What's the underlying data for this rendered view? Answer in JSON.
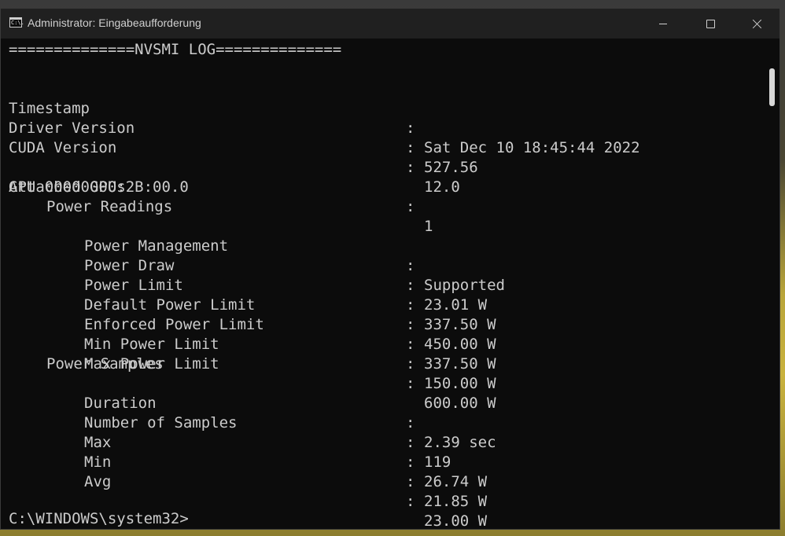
{
  "window": {
    "title": "Administrator: Eingabeaufforderung",
    "icon": "cmd-icon",
    "icon_text": "C:\\."
  },
  "console": {
    "header": "==============NVSMI LOG==============",
    "top_fields": [
      {
        "key": "Timestamp",
        "sep": ":",
        "value": "Sat Dec 10 18:45:44 2022"
      },
      {
        "key": "Driver Version",
        "sep": ":",
        "value": "527.56"
      },
      {
        "key": "CUDA Version",
        "sep": ":",
        "value": "12.0"
      }
    ],
    "attached": {
      "key": "Attached GPUs",
      "sep": ":",
      "value": "1"
    },
    "gpu_id": "GPU 00000000:2B:00.0",
    "power_readings_label": "Power Readings",
    "power_readings": [
      {
        "key": "Power Management",
        "sep": ":",
        "value": "Supported"
      },
      {
        "key": "Power Draw",
        "sep": ":",
        "value": "23.01 W"
      },
      {
        "key": "Power Limit",
        "sep": ":",
        "value": "337.50 W"
      },
      {
        "key": "Default Power Limit",
        "sep": ":",
        "value": "450.00 W"
      },
      {
        "key": "Enforced Power Limit",
        "sep": ":",
        "value": "337.50 W"
      },
      {
        "key": "Min Power Limit",
        "sep": ":",
        "value": "150.00 W"
      },
      {
        "key": "Max Power Limit",
        "sep": ":",
        "value": "600.00 W"
      }
    ],
    "power_samples_label": "Power Samples",
    "power_samples": [
      {
        "key": "Duration",
        "sep": ":",
        "value": "2.39 sec"
      },
      {
        "key": "Number of Samples",
        "sep": ":",
        "value": "119"
      },
      {
        "key": "Max",
        "sep": ":",
        "value": "26.74 W"
      },
      {
        "key": "Min",
        "sep": ":",
        "value": "21.85 W"
      },
      {
        "key": "Avg",
        "sep": ":",
        "value": "23.00 W"
      }
    ],
    "prompt": "C:\\WINDOWS\\system32>"
  }
}
